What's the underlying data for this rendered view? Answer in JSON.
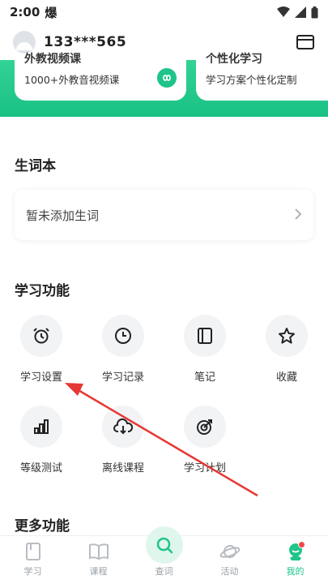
{
  "status": {
    "time": "2:00",
    "notif": "爆"
  },
  "profile": {
    "username": "133***565"
  },
  "promos": [
    {
      "title": "外教视频课",
      "subtitle": "1000+外教音视频课"
    },
    {
      "title": "个性化学习",
      "subtitle": "学习方案个性化定制"
    }
  ],
  "vocab": {
    "title": "生词本",
    "empty_text": "暂未添加生词"
  },
  "functions": {
    "title": "学习功能",
    "items": [
      {
        "label": "学习设置",
        "icon": "alarm-clock-icon"
      },
      {
        "label": "学习记录",
        "icon": "clock-icon"
      },
      {
        "label": "笔记",
        "icon": "notebook-icon"
      },
      {
        "label": "收藏",
        "icon": "star-icon"
      },
      {
        "label": "等级测试",
        "icon": "bar-chart-icon"
      },
      {
        "label": "离线课程",
        "icon": "cloud-download-icon"
      },
      {
        "label": "学习计划",
        "icon": "target-icon"
      }
    ]
  },
  "more": {
    "title": "更多功能"
  },
  "tabs": [
    {
      "label": "学习",
      "icon": "book-icon"
    },
    {
      "label": "课程",
      "icon": "open-book-icon"
    },
    {
      "label": "查词",
      "icon": "search-icon"
    },
    {
      "label": "活动",
      "icon": "planet-icon"
    },
    {
      "label": "我的",
      "icon": "profile-icon"
    }
  ],
  "colors": {
    "accent": "#1fc48a",
    "annotation": "#e53935"
  }
}
